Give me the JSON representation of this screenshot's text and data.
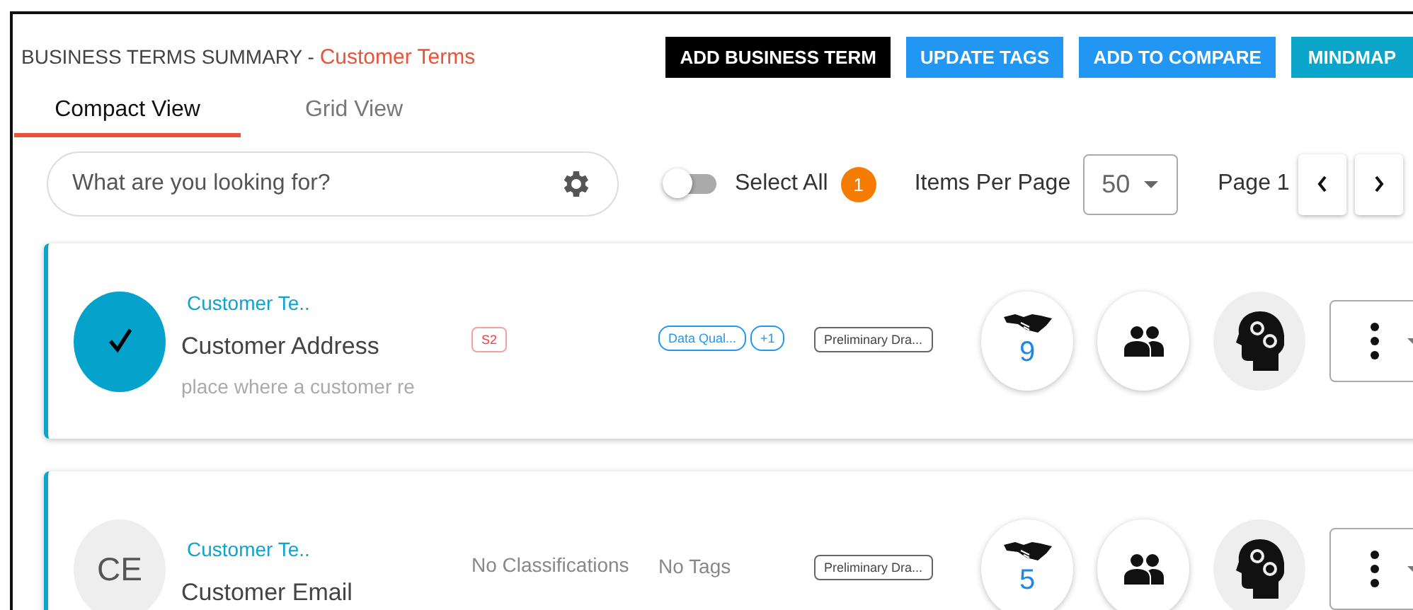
{
  "header": {
    "title": "BUSINESS TERMS SUMMARY - ",
    "subtitle": "Customer Terms"
  },
  "actions": [
    {
      "label": "ADD BUSINESS TERM",
      "kind": "dark"
    },
    {
      "label": "UPDATE TAGS",
      "kind": "primary"
    },
    {
      "label": "ADD TO COMPARE",
      "kind": "primary"
    },
    {
      "label": "MINDMAP",
      "kind": "teal"
    }
  ],
  "tabs": [
    {
      "label": "Compact View",
      "selected": true
    },
    {
      "label": "Grid View",
      "selected": false
    }
  ],
  "search": {
    "placeholder": "What are you looking for?"
  },
  "select_all": {
    "label": "Select All",
    "on": false,
    "count": "1"
  },
  "pagination": {
    "label": "Items Per Page",
    "per_page": "50",
    "page": "Page 1"
  },
  "terms": [
    {
      "selected": true,
      "category": "Customer Te..",
      "name": "Customer Address",
      "description": "place where a customer re",
      "classification": {
        "kind": "chip",
        "text": "S2"
      },
      "tags": {
        "kind": "chips",
        "items": [
          "Data Qual...",
          "+1"
        ]
      },
      "status": "Preliminary Dra...",
      "count": "9"
    },
    {
      "selected": false,
      "initials": "CE",
      "category": "Customer Te..",
      "name": "Customer Email",
      "classification": {
        "kind": "none",
        "text": "No Classifications"
      },
      "tags": {
        "kind": "none",
        "text": "No Tags"
      },
      "status": "Preliminary Dra...",
      "count": "5"
    }
  ]
}
